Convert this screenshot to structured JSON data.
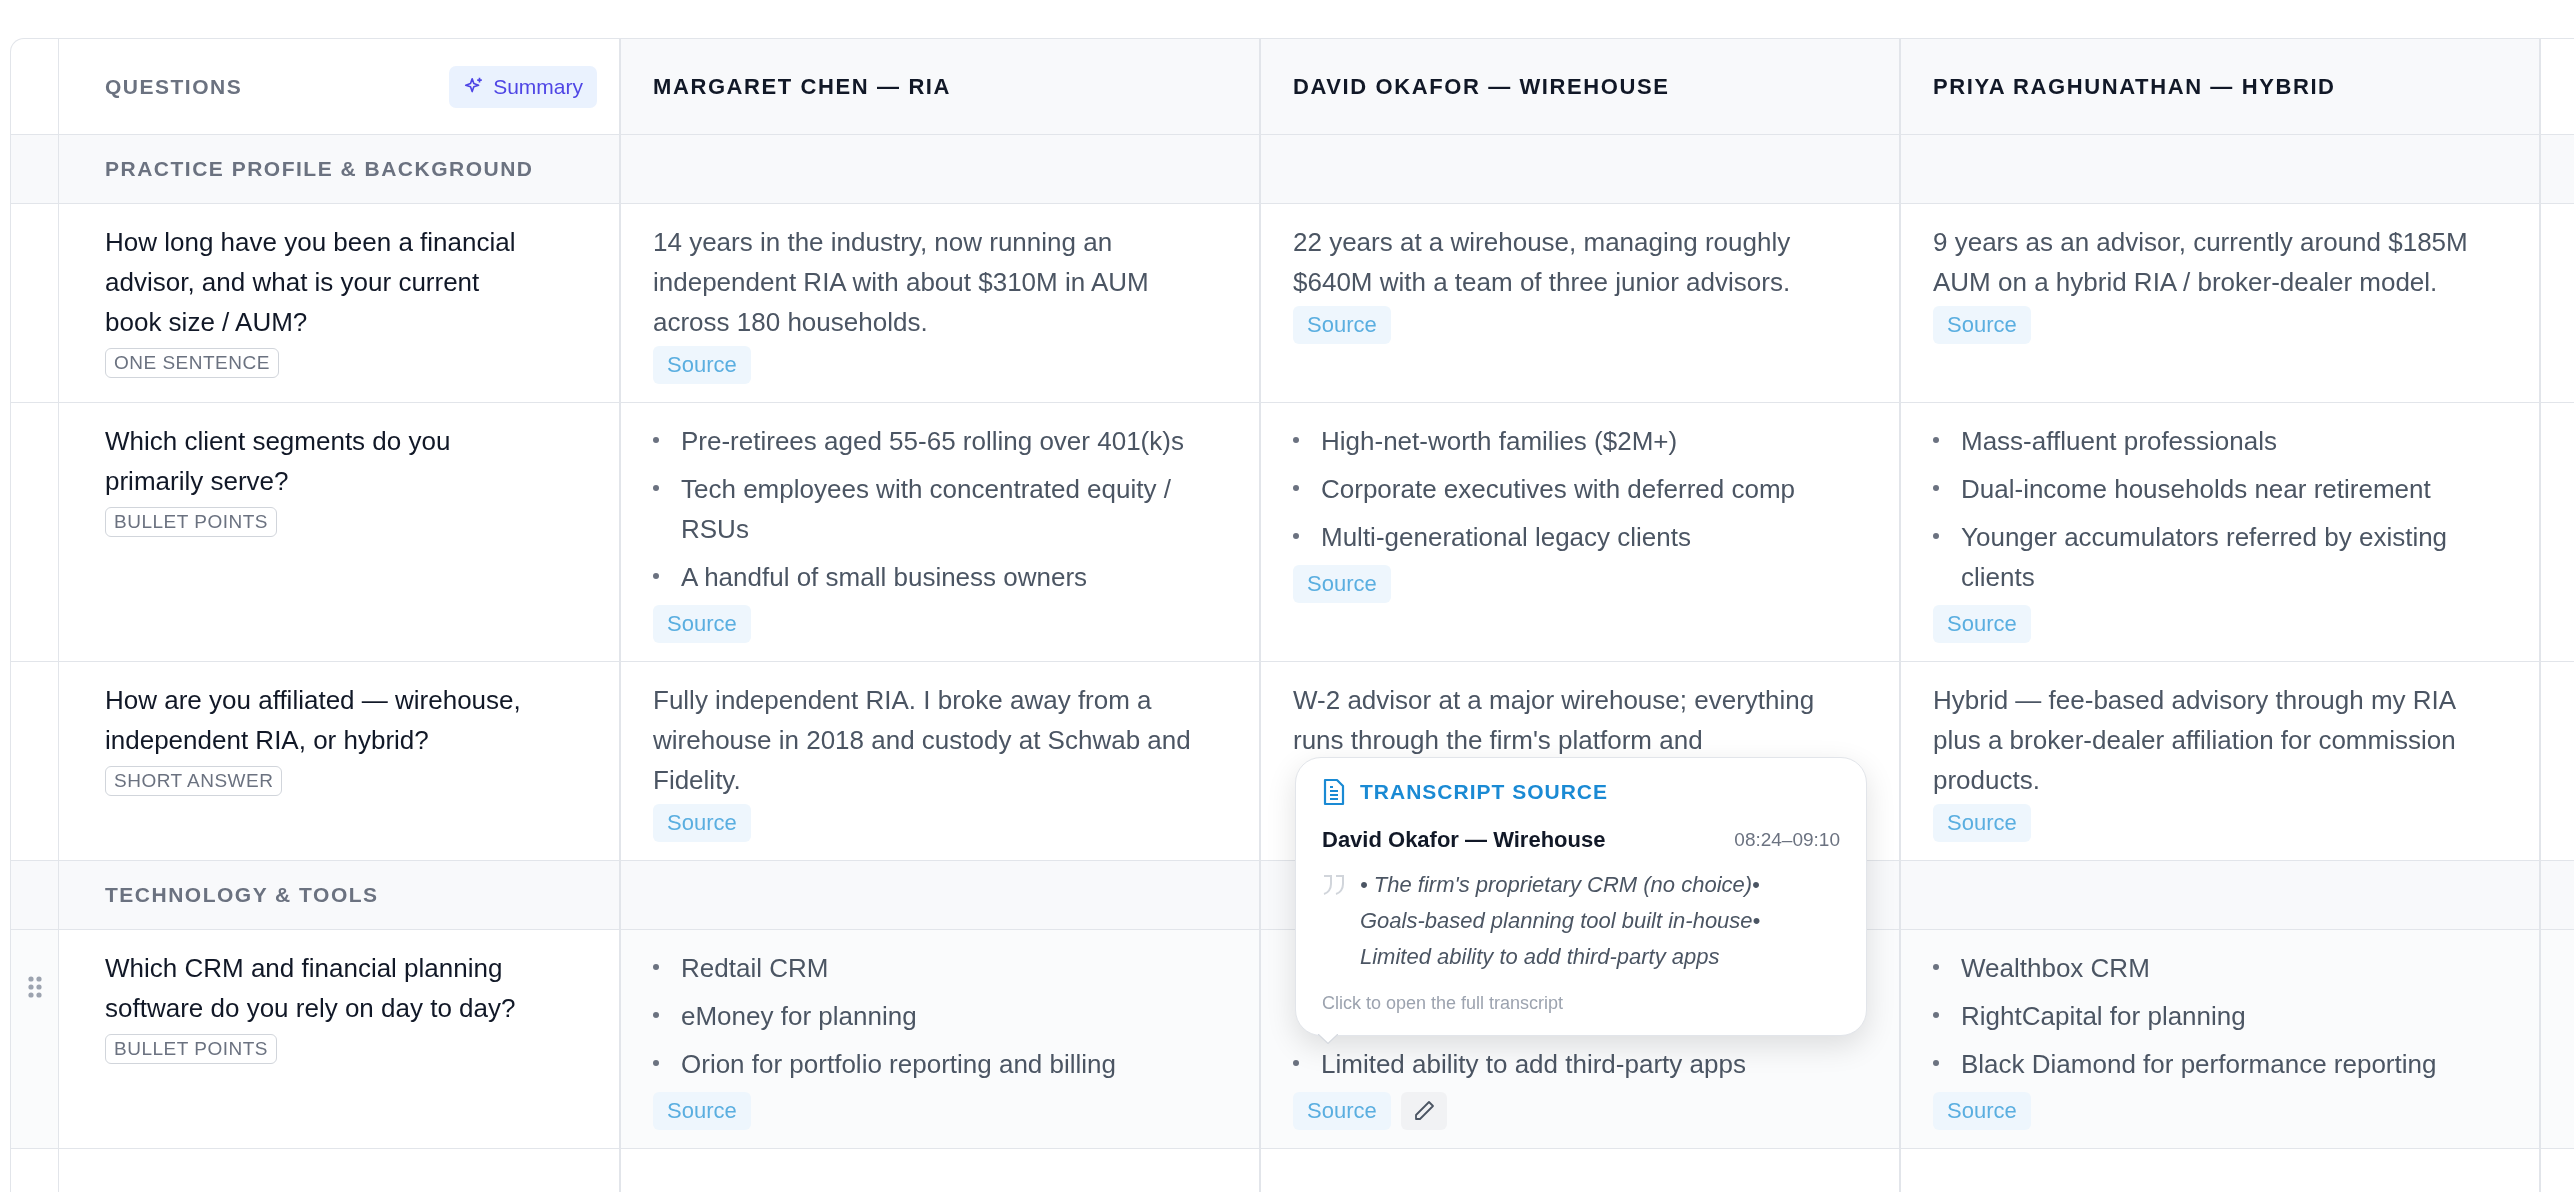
{
  "table": {
    "questions_header": "QUESTIONS",
    "summary_button": "Summary",
    "columns": [
      "MARGARET CHEN — RIA",
      "DAVID OKAFOR — WIREHOUSE",
      "PRIYA RAGHUNATHAN — HYBRID"
    ],
    "sections": [
      {
        "title": "PRACTICE PROFILE & BACKGROUND",
        "rows": [
          {
            "question": "How long have you been a financial advisor, and what is your current book size / AUM?",
            "format": "ONE SENTENCE",
            "hovered": false,
            "cells": [
              {
                "kind": "text",
                "text": "14 years in the industry, now running an independent RIA with about $310M in AUM across 180 households.",
                "source": "Source"
              },
              {
                "kind": "text",
                "text": "22 years at a wirehouse, managing roughly $640M with a team of three junior advisors.",
                "source": "Source"
              },
              {
                "kind": "text",
                "text": "9 years as an advisor, currently around $185M AUM on a hybrid RIA / broker-dealer model.",
                "source": "Source"
              }
            ]
          },
          {
            "question": "Which client segments do you primarily serve?",
            "format": "BULLET POINTS",
            "hovered": false,
            "cells": [
              {
                "kind": "bullets",
                "bullets": [
                  "Pre-retirees aged 55-65 rolling over 401(k)s",
                  "Tech employees with concentrated equity / RSUs",
                  "A handful of small business owners"
                ],
                "source": "Source"
              },
              {
                "kind": "bullets",
                "bullets": [
                  "High-net-worth families ($2M+)",
                  "Corporate executives with deferred comp",
                  "Multi-generational legacy clients"
                ],
                "source": "Source"
              },
              {
                "kind": "bullets",
                "bullets": [
                  "Mass-affluent professionals",
                  "Dual-income households near retirement",
                  "Younger accumulators referred by existing clients"
                ],
                "source": "Source"
              }
            ]
          },
          {
            "question": "How are you affiliated — wirehouse, independent RIA, or hybrid?",
            "format": "SHORT ANSWER",
            "hovered": false,
            "cells": [
              {
                "kind": "text",
                "text": "Fully independent RIA. I broke away from a wirehouse in 2018 and custody at Schwab and Fidelity.",
                "source": "Source"
              },
              {
                "kind": "text",
                "text": "W-2 advisor at a major wirehouse; everything runs through the firm's platform and"
              },
              {
                "kind": "text",
                "text": "Hybrid — fee-based advisory through my RIA plus a broker-dealer affiliation for commission products.",
                "source": "Source"
              }
            ]
          }
        ]
      },
      {
        "title": "TECHNOLOGY & TOOLS",
        "rows": [
          {
            "question": "Which CRM and financial planning software do you rely on day to day?",
            "format": "BULLET POINTS",
            "hovered": true,
            "cells": [
              {
                "kind": "bullets",
                "bullets": [
                  "Redtail CRM",
                  "eMoney for planning",
                  "Orion for portfolio reporting and billing"
                ],
                "source": "Source"
              },
              {
                "kind": "bullets",
                "bullets": [
                  "Limited ability to add third-party apps"
                ],
                "source": "Source",
                "editable": true
              },
              {
                "kind": "bullets",
                "bullets": [
                  "Wealthbox CRM",
                  "RightCapital for planning",
                  "Black Diamond for performance reporting"
                ],
                "source": "Source"
              }
            ]
          }
        ]
      }
    ]
  },
  "source_popover": {
    "title": "TRANSCRIPT SOURCE",
    "speaker": "David Okafor — Wirehouse",
    "time": "08:24–09:10",
    "quote": "• The firm's proprietary CRM (no choice)• Goals-based planning tool built in-house• Limited ability to add third-party apps",
    "footer": "Click to open the full transcript"
  }
}
